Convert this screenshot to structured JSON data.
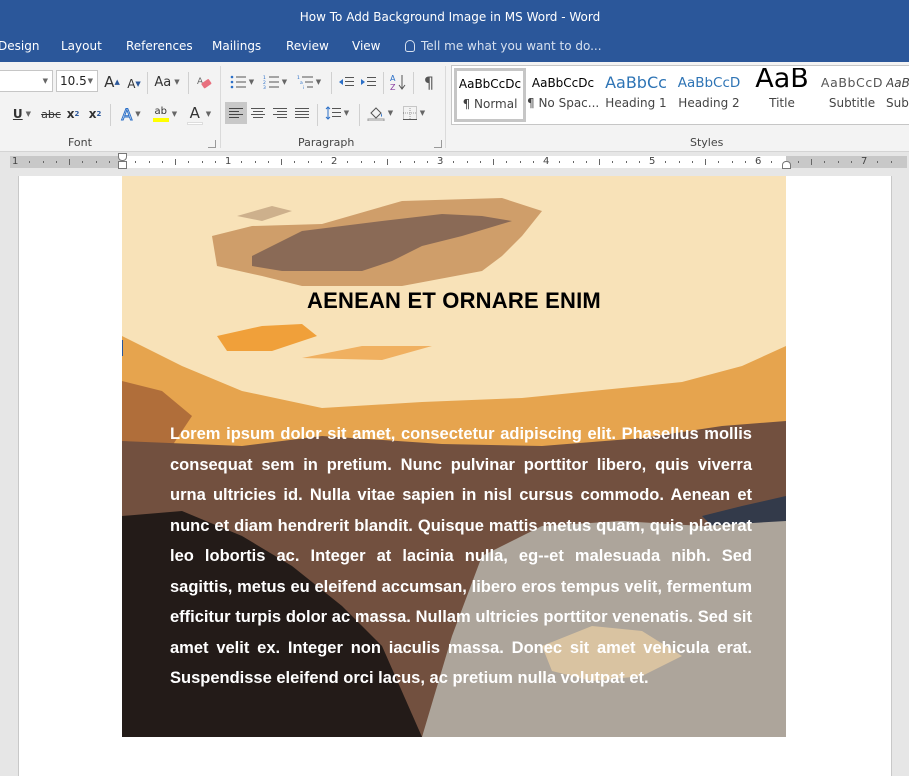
{
  "window": {
    "title": "How To Add Background Image in MS Word - Word"
  },
  "tabs": [
    {
      "label": "Design"
    },
    {
      "label": "Layout"
    },
    {
      "label": "References"
    },
    {
      "label": "Mailings"
    },
    {
      "label": "Review"
    },
    {
      "label": "View"
    }
  ],
  "tell_me": {
    "icon": "lightbulb-icon",
    "placeholder": "Tell me what you want to do..."
  },
  "ribbon": {
    "font": {
      "label": "Font",
      "font_name": "",
      "font_size": "10.5",
      "grow_font": "A",
      "shrink_font": "A",
      "change_case": "Aa",
      "underline": "U",
      "strikethrough": "abc",
      "subscript": "x",
      "superscript": "x",
      "text_effects": "A",
      "highlight": "ab",
      "font_color": "A",
      "highlight_color": "#ffff00",
      "font_color_value": "#ffffff"
    },
    "paragraph": {
      "label": "Paragraph",
      "show_hide": "¶"
    },
    "styles": {
      "label": "Styles",
      "items": [
        {
          "sample": "AaBbCcDc",
          "name": "¶ Normal",
          "selected": true
        },
        {
          "sample": "AaBbCcDc",
          "name": "¶ No Spac..."
        },
        {
          "sample": "AaBbCc",
          "name": "Heading 1"
        },
        {
          "sample": "AaBbCcD",
          "name": "Heading 2"
        },
        {
          "sample": "AaB",
          "name": "Title"
        },
        {
          "sample": "AaBbCcD",
          "name": "Subtitle"
        },
        {
          "sample": "AaB",
          "name": "Sub"
        }
      ]
    }
  },
  "ruler": {
    "numbers": [
      "1",
      "1",
      "2",
      "3",
      "4",
      "5",
      "6",
      "7"
    ]
  },
  "document": {
    "heading": "AENEAN ET ORNARE ENIM",
    "body": "Lorem ipsum dolor sit amet, consectetur adipiscing elit. Phasellus mollis consequat sem in pretium. Nunc pulvinar porttitor libero, quis viverra urna ultricies id. Nulla vitae sapien in nisl cursus commodo. Aenean et nunc et diam hendrerit blandit. Quisque mattis metus quam, quis placerat leo lobortis ac. Integer at lacinia nulla, eg--et malesuada nibh. Sed sagittis, metus eu eleifend accumsan, libero eros tempus velit, fermentum efficitur turpis dolor ac massa. Nullam ultricies porttitor venenatis. Sed sit amet velit ex. Integer non iaculis massa. Donec sit amet vehicula erat. Suspendisse eleifend orci lacus, ac pretium nulla volutpat et.",
    "background_image": "desert-sunset-landscape",
    "palette": {
      "sky": "#f8e2b8",
      "cloud_light": "#cf9e6a",
      "cloud_dark": "#8a6a56",
      "orange": "#f0a03a",
      "hills": "#e6a44e",
      "brown": "#72503f",
      "dark": "#231b18",
      "grey": "#ada59b",
      "navy": "#333a4a"
    }
  }
}
